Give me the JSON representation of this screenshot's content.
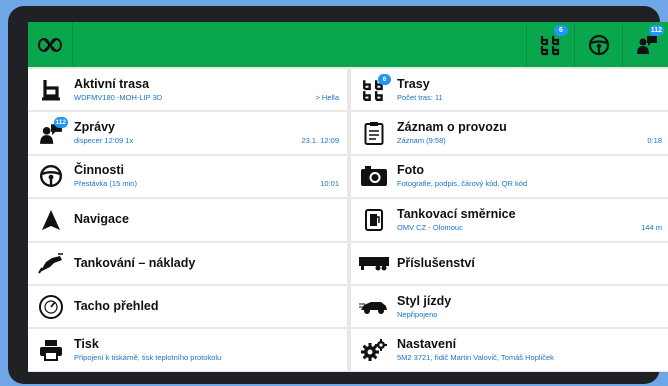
{
  "topbar": {
    "logo_icon": "network-logo-icon",
    "buttons": [
      {
        "icon": "routes-icon",
        "badge": "6"
      },
      {
        "icon": "steering-wheel-icon",
        "badge": ""
      },
      {
        "icon": "messages-icon",
        "badge": "112"
      }
    ]
  },
  "left": [
    {
      "title": "Aktivní trasa",
      "sub": "WDFMV180 -MOH-LIP 3D",
      "right": "> Hella",
      "icon": "active-route-icon",
      "badge": ""
    },
    {
      "title": "Zprávy",
      "sub": "dispecer 12:09 1x",
      "right": "23.1. 12:09",
      "icon": "messages-icon",
      "badge": "112"
    },
    {
      "title": "Činnosti",
      "sub": "Přestávka (15 min)",
      "right": "10:01",
      "icon": "steering-wheel-icon",
      "badge": ""
    },
    {
      "title": "Navigace",
      "sub": "",
      "right": "",
      "icon": "navigation-arrow-icon",
      "badge": ""
    },
    {
      "title": "Tankování – náklady",
      "sub": "",
      "right": "",
      "icon": "fuel-nozzle-icon",
      "badge": ""
    },
    {
      "title": "Tacho přehled",
      "sub": "",
      "right": "",
      "icon": "tachograph-icon",
      "badge": ""
    },
    {
      "title": "Tisk",
      "sub": "Připojení k tiskárně, tisk teplotního protokolu",
      "right": "",
      "icon": "printer-icon",
      "badge": ""
    }
  ],
  "right": [
    {
      "title": "Trasy",
      "sub": "Počet tras: 11",
      "right": "",
      "icon": "routes-icon",
      "badge": "6"
    },
    {
      "title": "Záznam o provozu",
      "sub": "Záznam (9:58)",
      "right": "0:18",
      "icon": "logbook-icon",
      "badge": ""
    },
    {
      "title": "Foto",
      "sub": "Fotografie, podpis, čárový kód, QR kód",
      "right": "",
      "icon": "camera-icon",
      "badge": ""
    },
    {
      "title": "Tankovací směrnice",
      "sub": "OMV CZ - Olomouc",
      "right": "144 m",
      "icon": "fuel-station-icon",
      "badge": ""
    },
    {
      "title": "Příslušenství",
      "sub": "",
      "right": "",
      "icon": "trailer-icon",
      "badge": ""
    },
    {
      "title": "Styl jízdy",
      "sub": "Nepřipojeno",
      "right": "",
      "icon": "car-icon",
      "badge": ""
    },
    {
      "title": "Nastavení",
      "sub": "5M2 3721, řidič Martin Valovič, Tomáš Hopliček",
      "right": "",
      "icon": "settings-gears-icon",
      "badge": ""
    }
  ]
}
